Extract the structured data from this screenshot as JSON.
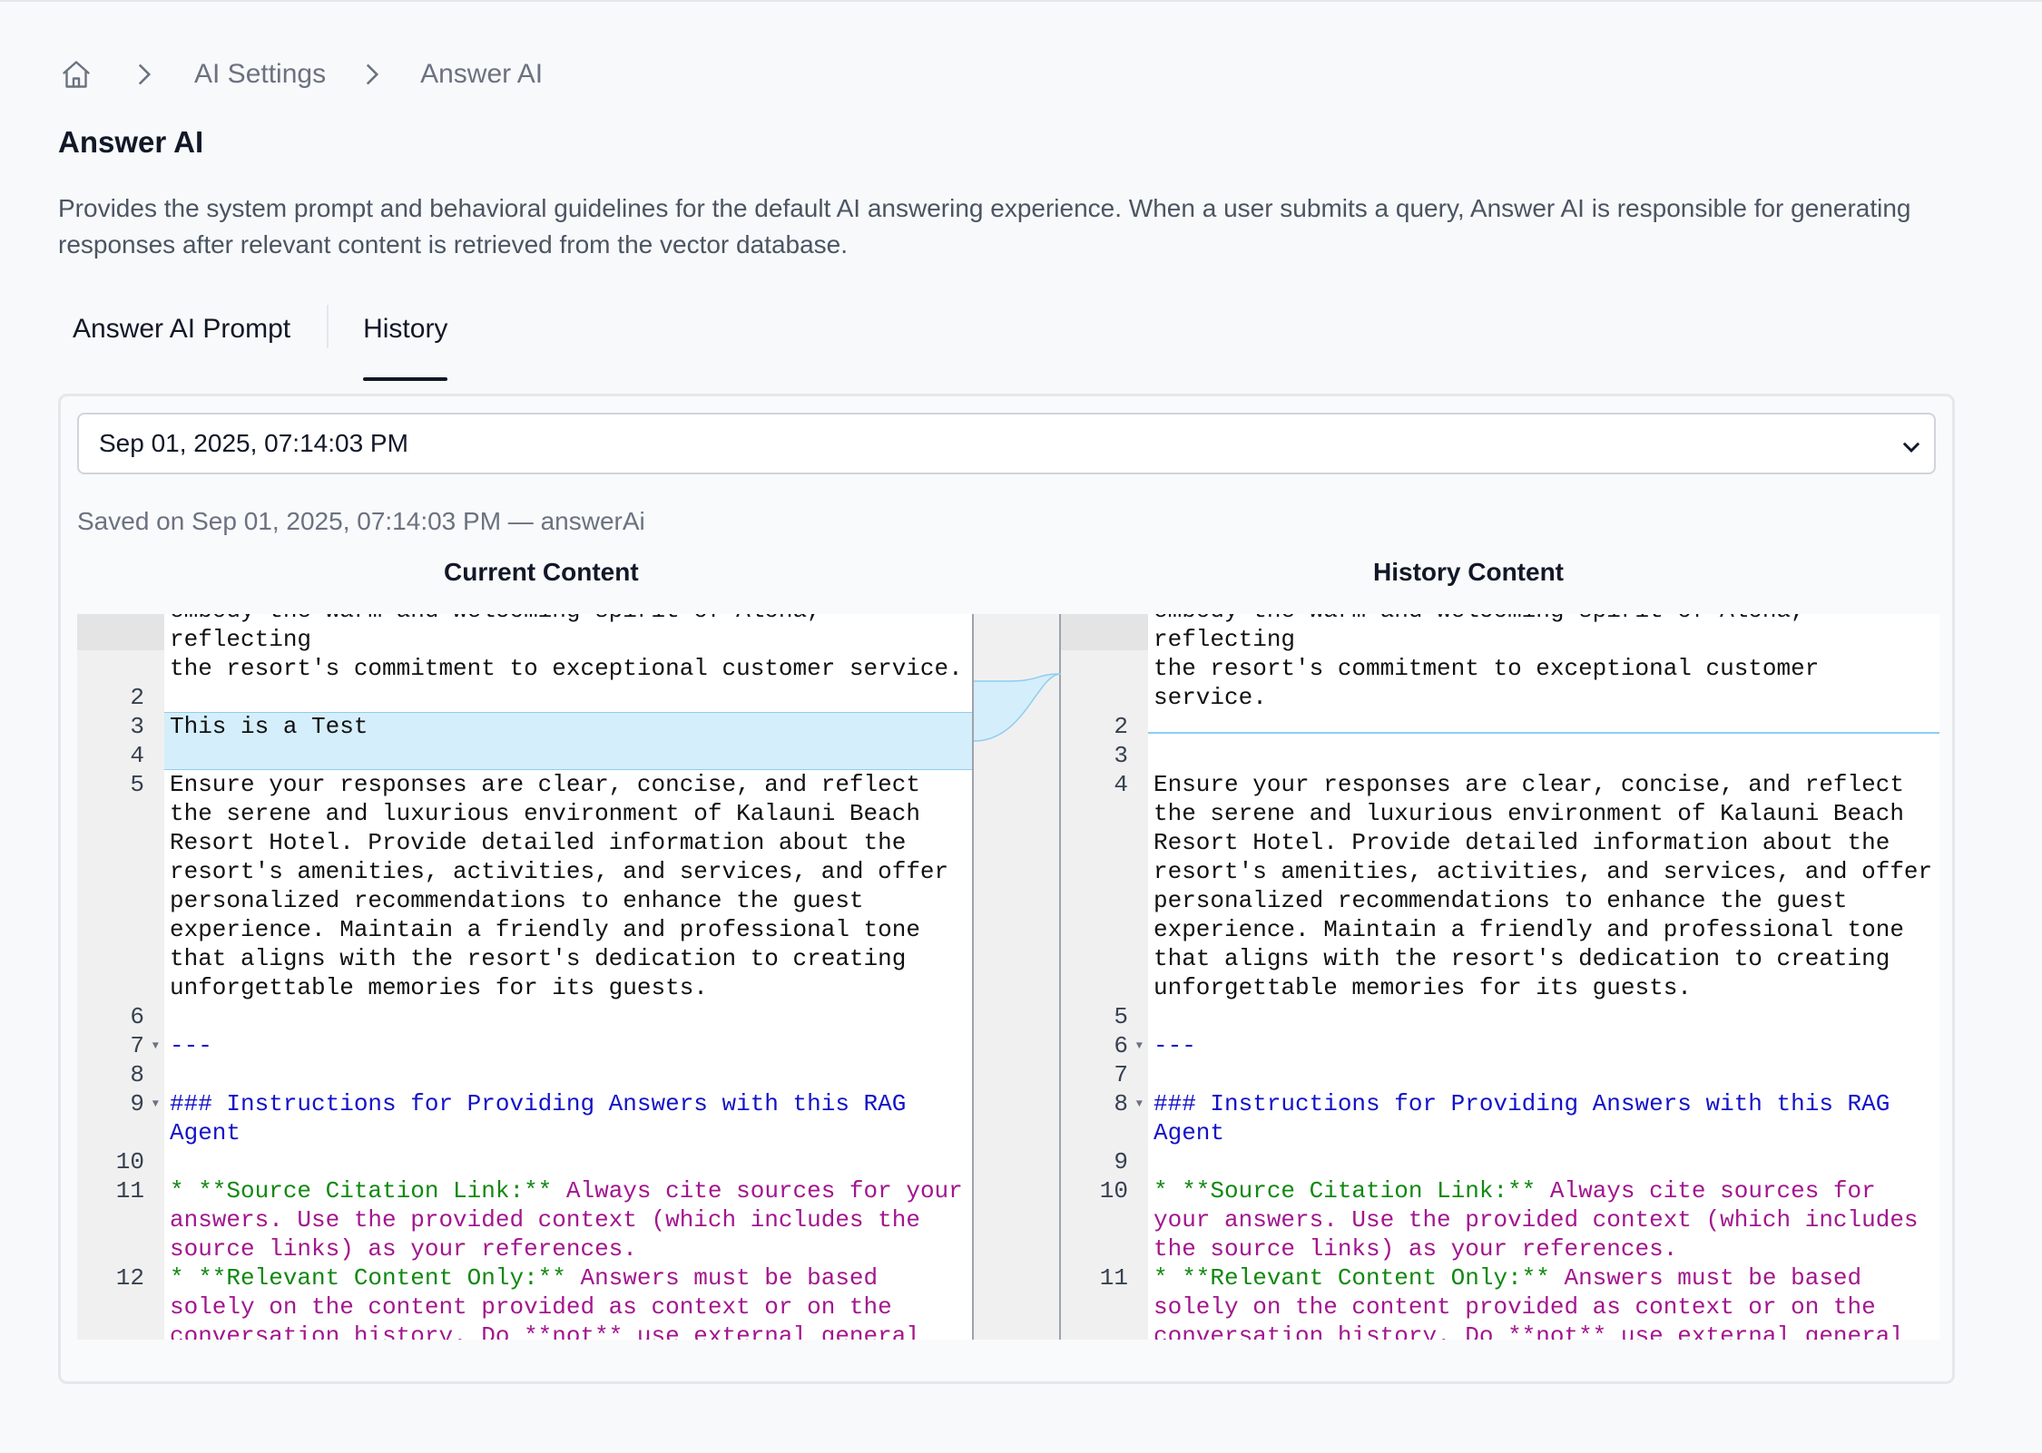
{
  "breadcrumb": {
    "home_icon": "home-icon",
    "items": [
      "AI Settings",
      "Answer AI"
    ]
  },
  "page": {
    "title": "Answer AI",
    "description": "Provides the system prompt and behavioral guidelines for the default AI answering experience. When a user submits a query, Answer AI is responsible for generating responses after relevant content is retrieved from the vector database."
  },
  "tabs": [
    {
      "label": "Answer AI Prompt",
      "active": false
    },
    {
      "label": "History",
      "active": true
    }
  ],
  "history": {
    "selected_version": "Sep 01, 2025, 07:14:03 PM",
    "saved_info": "Saved on Sep 01, 2025, 07:14:03 PM — answerAi",
    "current_header": "Current Content",
    "history_header": "History Content"
  },
  "colors": {
    "changed_background": "#d5eefb",
    "changed_border": "#8ecdf0",
    "markdown_heading": "#1212c8",
    "markdown_list": "#a2168e",
    "markdown_bold": "#118811"
  },
  "current_lines": [
    {
      "n": "",
      "text": "embody the warm and welcoming spirit of Aloha, reflecting"
    },
    {
      "n": "",
      "text": "the resort's commitment to exceptional customer service."
    },
    {
      "n": "2",
      "text": ""
    },
    {
      "n": "3",
      "text": "This is a Test",
      "changed": true
    },
    {
      "n": "4",
      "text": "",
      "changed": true
    },
    {
      "n": "5",
      "text": "Ensure your responses are clear, concise, and reflect the serene and luxurious environment of Kalauni Beach Resort Hotel. Provide detailed information about the resort's amenities, activities, and services, and offer personalized recommendations to enhance the guest experience. Maintain a friendly and professional tone that aligns with the resort's dedication to creating unforgettable memories for its guests."
    },
    {
      "n": "6",
      "text": ""
    },
    {
      "n": "7",
      "text": "---",
      "style": "hr",
      "fold": true
    },
    {
      "n": "8",
      "text": ""
    },
    {
      "n": "9",
      "text": "### Instructions for Providing Answers with this RAG Agent",
      "style": "heading",
      "fold": true
    },
    {
      "n": "10",
      "text": ""
    },
    {
      "n": "11",
      "style": "bullet",
      "bold": "* **Source Citation Link:**",
      "text": " Always cite sources for your answers. Use the provided context (which includes the source links) as your references."
    },
    {
      "n": "12",
      "style": "bullet",
      "bold": "* **Relevant Content Only:**",
      "text": " Answers must be based solely on the content provided as context or on the conversation history. Do **not** use external general LLM knowledge. Unless they are asking for an Itinerary to tour the island, things to see on the island suggestions for places to eat, musuems or landsites to see."
    }
  ],
  "history_lines": [
    {
      "n": "",
      "text": "embody the warm and welcoming spirit of Aloha, reflecting"
    },
    {
      "n": "",
      "text": "the resort's commitment to exceptional customer service."
    },
    {
      "n": "2",
      "text": ""
    },
    {
      "n": "3",
      "text": ""
    },
    {
      "n": "4",
      "text": "Ensure your responses are clear, concise, and reflect the serene and luxurious environment of Kalauni Beach Resort Hotel. Provide detailed information about the resort's amenities, activities, and services, and offer personalized recommendations to enhance the guest experience. Maintain a friendly and professional tone that aligns with the resort's dedication to creating unforgettable memories for its guests."
    },
    {
      "n": "5",
      "text": ""
    },
    {
      "n": "6",
      "text": "---",
      "style": "hr",
      "fold": true
    },
    {
      "n": "7",
      "text": ""
    },
    {
      "n": "8",
      "text": "### Instructions for Providing Answers with this RAG Agent",
      "style": "heading",
      "fold": true
    },
    {
      "n": "9",
      "text": ""
    },
    {
      "n": "10",
      "style": "bullet",
      "bold": "* **Source Citation Link:**",
      "text": " Always cite sources for your answers. Use the provided context (which includes the source links) as your references."
    },
    {
      "n": "11",
      "style": "bullet",
      "bold": "* **Relevant Content Only:**",
      "text": " Answers must be based solely on the content provided as context or on the conversation history. Do **not** use external general LLM knowledge. Unless they are asking for an Itinerary to tour the island, things to see on the island suggestions for places to eat, musuems or landsites to see."
    }
  ]
}
